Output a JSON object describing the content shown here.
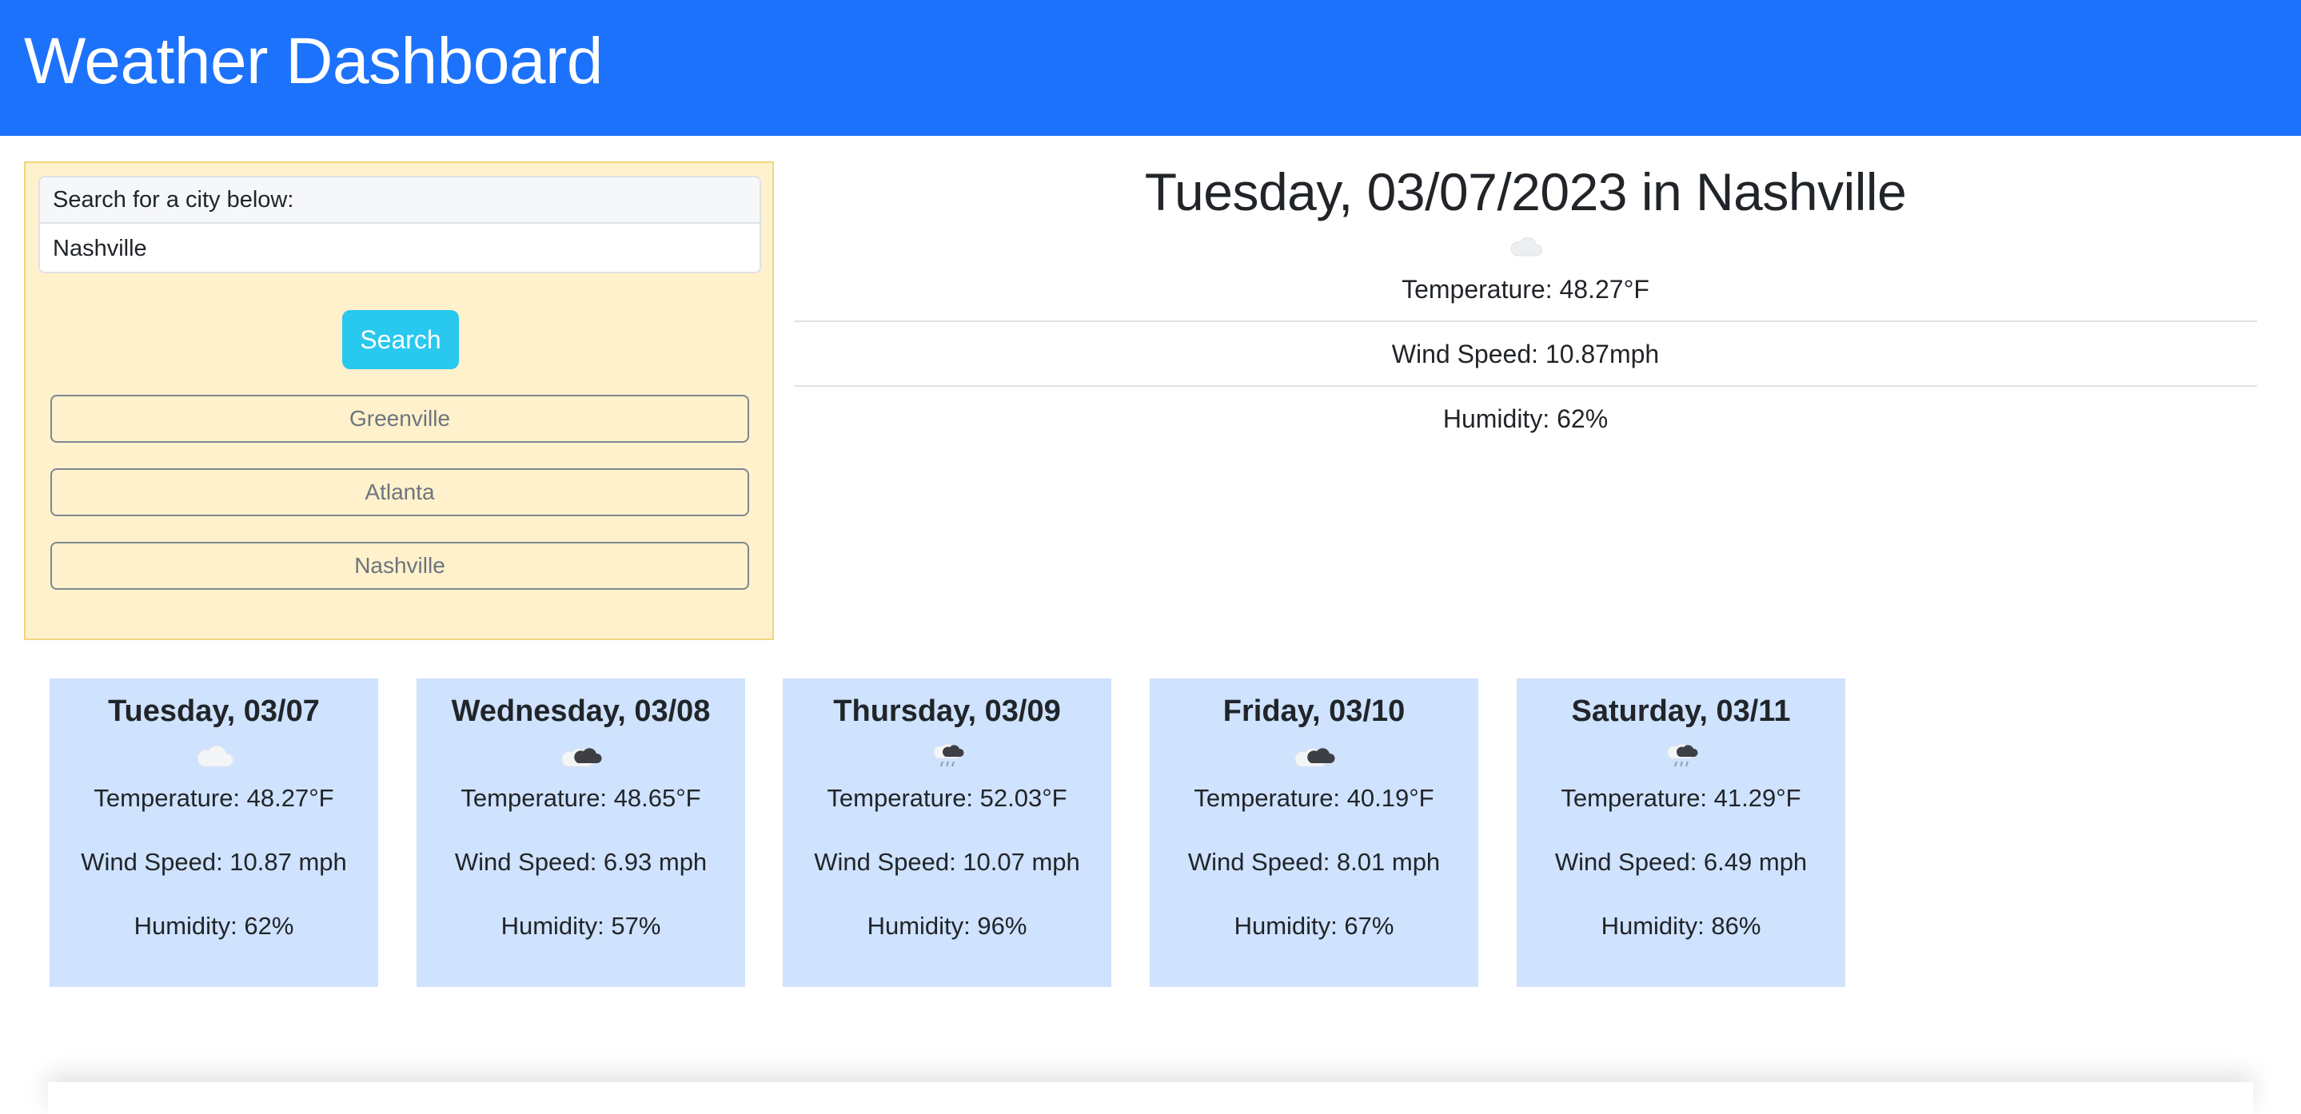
{
  "header": {
    "title": "Weather Dashboard"
  },
  "search": {
    "label": "Search for a city below:",
    "value": "Nashville",
    "button_label": "Search"
  },
  "history": [
    "Greenville",
    "Atlanta",
    "Nashville"
  ],
  "current": {
    "title": "Tuesday, 03/07/2023 in Nashville",
    "icon": "cloud-icon",
    "temperature": "Temperature: 48.27°F",
    "wind": "Wind Speed: 10.87mph",
    "humidity": "Humidity: 62%"
  },
  "forecast": [
    {
      "date": "Tuesday, 03/07",
      "icon": "cloud-icon",
      "temperature": "Temperature: 48.27°F",
      "wind": "Wind Speed: 10.87 mph",
      "humidity": "Humidity: 62%"
    },
    {
      "date": "Wednesday, 03/08",
      "icon": "broken-clouds-icon",
      "temperature": "Temperature: 48.65°F",
      "wind": "Wind Speed: 6.93 mph",
      "humidity": "Humidity: 57%"
    },
    {
      "date": "Thursday, 03/09",
      "icon": "rain-cloud-icon",
      "temperature": "Temperature: 52.03°F",
      "wind": "Wind Speed: 10.07 mph",
      "humidity": "Humidity: 96%"
    },
    {
      "date": "Friday, 03/10",
      "icon": "broken-clouds-icon",
      "temperature": "Temperature: 40.19°F",
      "wind": "Wind Speed: 8.01 mph",
      "humidity": "Humidity: 67%"
    },
    {
      "date": "Saturday, 03/11",
      "icon": "rain-cloud-icon",
      "temperature": "Temperature: 41.29°F",
      "wind": "Wind Speed: 6.49 mph",
      "humidity": "Humidity: 86%"
    }
  ],
  "colors": {
    "header": "#1d72fb",
    "search_panel": "#fff1cc",
    "search_button": "#29c8ee",
    "forecast_card": "#cfe2fe"
  }
}
